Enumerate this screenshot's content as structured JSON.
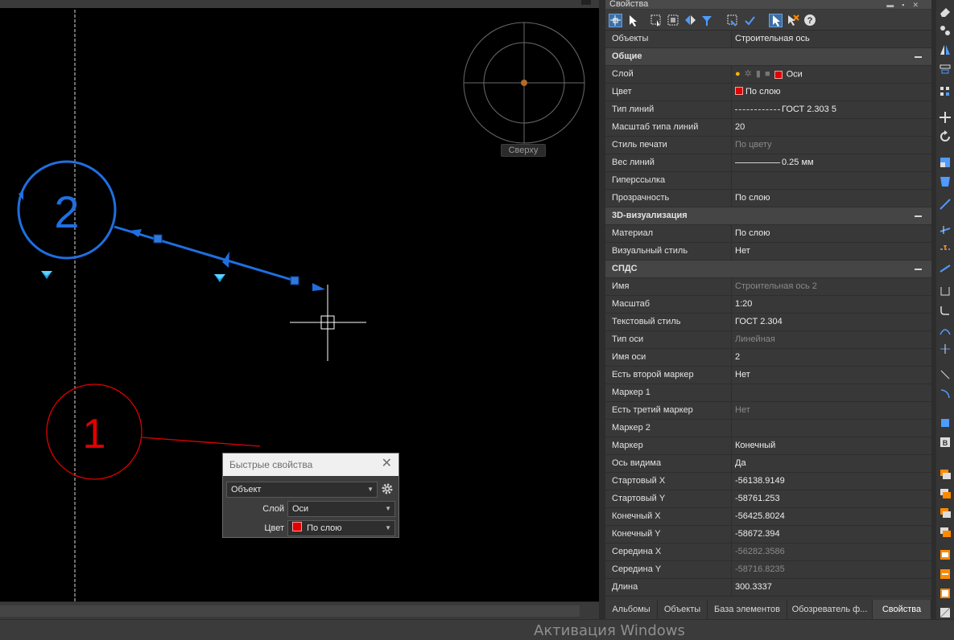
{
  "canvas": {
    "viewcube_label": "Сверху",
    "axis_2_label": "2",
    "axis_1_label": "1"
  },
  "panel": {
    "title": "Свойства",
    "rows": [
      {
        "key": "Объекты",
        "value": "Строительная ось",
        "type": "top"
      },
      {
        "key": "Общие",
        "type": "section"
      },
      {
        "key": "Слой",
        "value": "Оси",
        "type": "layer"
      },
      {
        "key": "Цвет",
        "value": "По слою",
        "type": "color"
      },
      {
        "key": "Тип линий",
        "value": "ГОСТ 2.303 5",
        "type": "linetype"
      },
      {
        "key": "Масштаб типа линий",
        "value": "20"
      },
      {
        "key": "Стиль печати",
        "value": "По цвету",
        "dim": true
      },
      {
        "key": "Вес линий",
        "value": "0.25 мм",
        "type": "lineweight"
      },
      {
        "key": "Гиперссылка",
        "value": ""
      },
      {
        "key": "Прозрачность",
        "value": "По слою"
      },
      {
        "key": "3D-визуализация",
        "type": "section"
      },
      {
        "key": "Материал",
        "value": "По слою"
      },
      {
        "key": "Визуальный стиль",
        "value": "Нет"
      },
      {
        "key": "СПДС",
        "type": "section"
      },
      {
        "key": "Имя",
        "value": "Строительная ось 2",
        "dim": true
      },
      {
        "key": "Масштаб",
        "value": "1:20"
      },
      {
        "key": "Текстовый стиль",
        "value": "ГОСТ 2.304"
      },
      {
        "key": "Тип оси",
        "value": "Линейная",
        "dim": true
      },
      {
        "key": "Имя оси",
        "value": "2"
      },
      {
        "key": "Есть второй маркер",
        "value": "Нет"
      },
      {
        "key": "Маркер 1",
        "value": ""
      },
      {
        "key": "Есть третий маркер",
        "value": "Нет",
        "dim": true
      },
      {
        "key": "Маркер 2",
        "value": ""
      },
      {
        "key": "Маркер",
        "value": "Конечный"
      },
      {
        "key": "Ось видима",
        "value": "Да"
      },
      {
        "key": "Стартовый X",
        "value": "-56138.9149"
      },
      {
        "key": "Стартовый Y",
        "value": "-58761.253"
      },
      {
        "key": "Конечный X",
        "value": "-56425.8024"
      },
      {
        "key": "Конечный Y",
        "value": "-58672.394"
      },
      {
        "key": "Середина X",
        "value": "-56282.3586",
        "dim": true
      },
      {
        "key": "Середина Y",
        "value": "-58716.8235",
        "dim": true
      },
      {
        "key": "Длина",
        "value": "300.3337"
      }
    ],
    "tabs": [
      {
        "label": "Альбомы",
        "active": false
      },
      {
        "label": "Объекты",
        "active": false
      },
      {
        "label": "База элементов",
        "active": false
      },
      {
        "label": "Обозреватель ф...",
        "active": false
      },
      {
        "label": "Свойства",
        "active": true
      }
    ]
  },
  "quick_props": {
    "title": "Быстрые свойства",
    "object_select": "Объект",
    "layer_label": "Слой",
    "layer_value": "Оси",
    "color_label": "Цвет",
    "color_value": "По слою"
  },
  "watermark": "Активация Windows",
  "colors": {
    "selection_blue": "#1f6fe0",
    "axis_red": "#e00000",
    "layer_color": "#e00000"
  }
}
